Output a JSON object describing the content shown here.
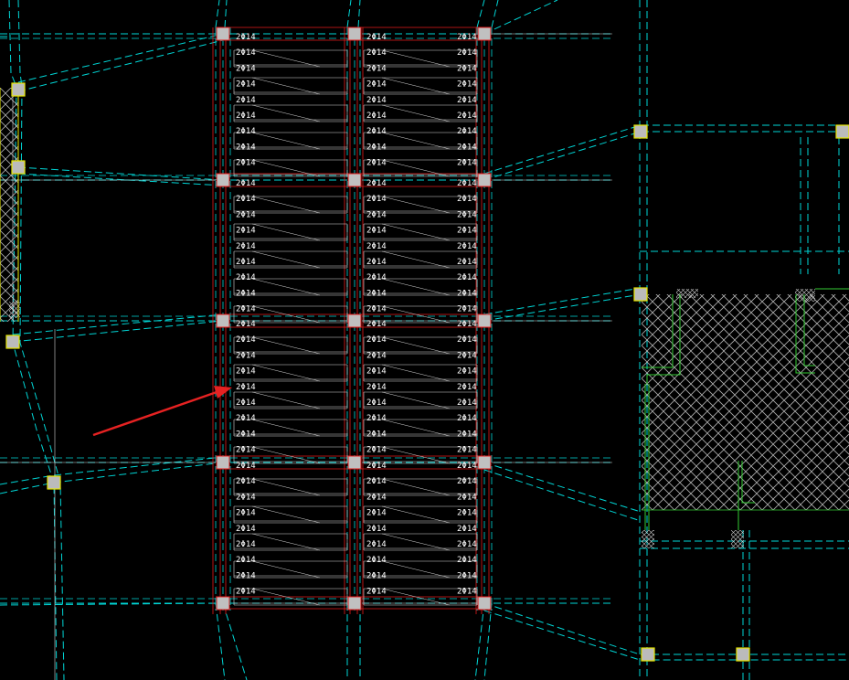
{
  "drawing": {
    "background": "#000000",
    "colors": {
      "axis": "#00d6d6",
      "beam": "#e61a1a",
      "rebar": "#ffffff",
      "column": "#c0c0c0",
      "column_yellow": "#e6e600",
      "wall": "#33cc33",
      "hatch": "#d0d0d0",
      "arrow": "#e62222",
      "white_line": "#d8d8d8"
    },
    "rebar_label": "2Φ14",
    "pointer_arrow": "red-arrow-icon"
  }
}
